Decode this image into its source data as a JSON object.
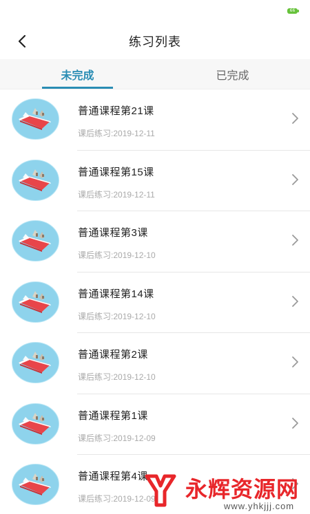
{
  "status_bar": {
    "battery": "66"
  },
  "nav": {
    "title": "练习列表",
    "back_icon": "chevron-left-icon"
  },
  "tabs": [
    {
      "label": "未完成",
      "active": true
    },
    {
      "label": "已完成",
      "active": false
    }
  ],
  "list": [
    {
      "title": "普通课程第21课",
      "date_label": "课后练习:",
      "date": "2019-12-11"
    },
    {
      "title": "普通课程第15课",
      "date_label": "课后练习:",
      "date": "2019-12-11"
    },
    {
      "title": "普通课程第3课",
      "date_label": "课后练习:",
      "date": "2019-12-10"
    },
    {
      "title": "普通课程第14课",
      "date_label": "课后练习:",
      "date": "2019-12-10"
    },
    {
      "title": "普通课程第2课",
      "date_label": "课后练习:",
      "date": "2019-12-10"
    },
    {
      "title": "普通课程第1课",
      "date_label": "课后练习:",
      "date": "2019-12-09"
    },
    {
      "title": "普通课程第4课",
      "date_label": "课后练习:",
      "date": "2019-12-09"
    }
  ],
  "watermark": {
    "title": "永辉资源网",
    "url": "www.yhkjjj.com"
  },
  "colors": {
    "accent": "#2a8db4",
    "thumb_bg": "#8ed3ec",
    "book_red": "#e8454a",
    "watermark_red": "#e8262a"
  }
}
